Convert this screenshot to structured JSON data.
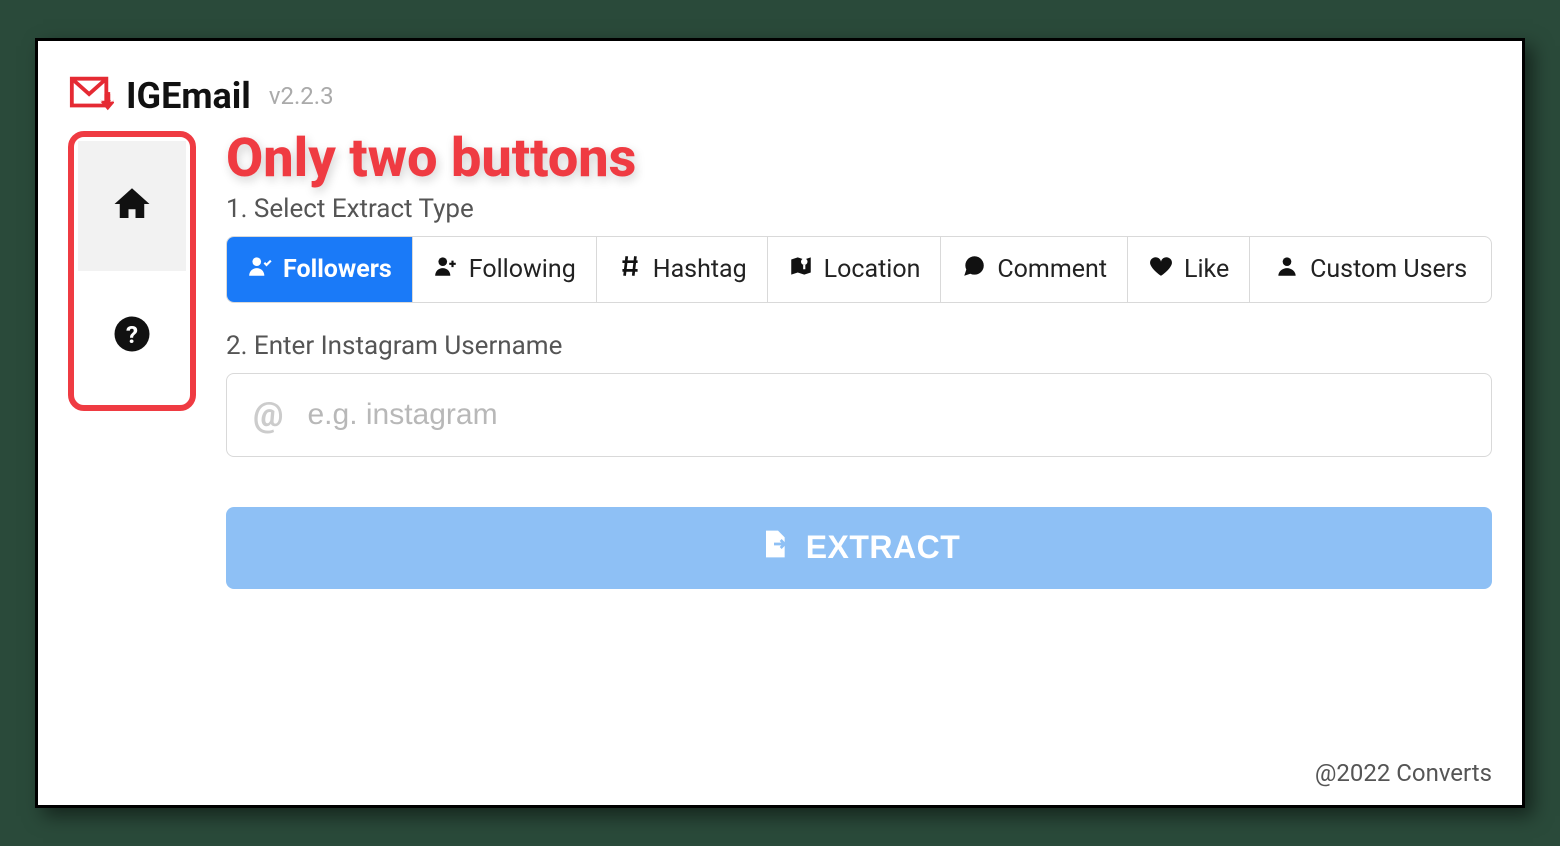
{
  "header": {
    "title": "IGEmail",
    "version": "v2.2.3"
  },
  "annotation": {
    "callout": "Only two buttons"
  },
  "steps": {
    "step1_label": "1. Select Extract Type",
    "step2_label": "2. Enter Instagram Username"
  },
  "tabs": {
    "followers": "Followers",
    "following": "Following",
    "hashtag": "Hashtag",
    "location": "Location",
    "comment": "Comment",
    "like": "Like",
    "custom_users": "Custom Users"
  },
  "input": {
    "prefix": "@",
    "placeholder": "e.g. instagram"
  },
  "actions": {
    "extract": "EXTRACT"
  },
  "footer": {
    "copyright": "@2022 Converts"
  },
  "colors": {
    "accent_red": "#ef3b42",
    "primary_blue": "#1a7af8",
    "disabled_blue": "#8ec0f5"
  }
}
